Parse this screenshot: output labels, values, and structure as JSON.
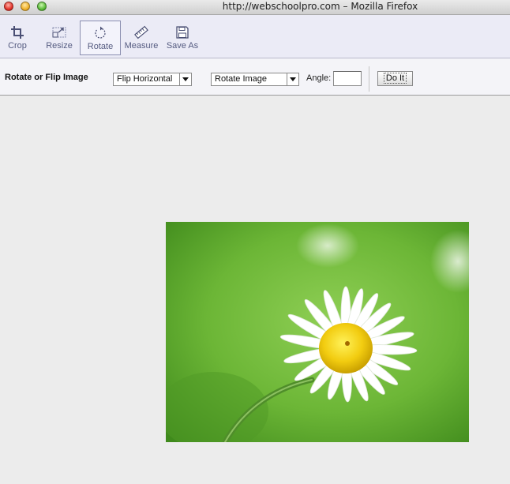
{
  "window": {
    "title": "http://webschoolpro.com – Mozilla Firefox"
  },
  "toolbar": {
    "tools": [
      {
        "label": "Crop",
        "icon": "crop-icon"
      },
      {
        "label": "Resize",
        "icon": "resize-icon"
      },
      {
        "label": "Rotate",
        "icon": "rotate-icon",
        "active": true
      },
      {
        "label": "Measure",
        "icon": "ruler-icon"
      },
      {
        "label": "Save As",
        "icon": "floppy-disk-icon"
      }
    ]
  },
  "options": {
    "title": "Rotate or Flip Image",
    "flip_select": {
      "selected": "Flip Horizontal"
    },
    "rotate_select": {
      "selected": "Rotate Image"
    },
    "angle_label": "Angle:",
    "angle_value": "",
    "do_it_label": "Do It"
  },
  "canvas": {
    "image_subject": "white daisy flower on green background"
  },
  "colors": {
    "toolbar_bg": "#ebebf6",
    "tool_text": "#555b80",
    "canvas_bg": "#ececec"
  }
}
